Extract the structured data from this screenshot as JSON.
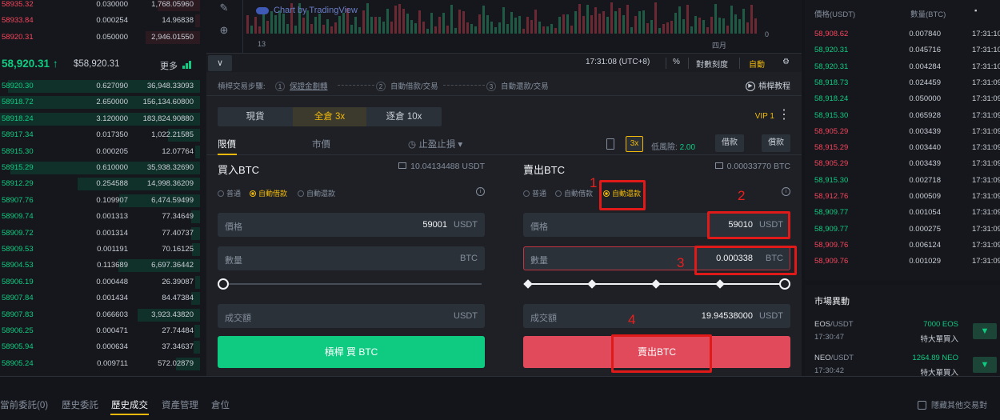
{
  "orderbook": {
    "asks": [
      {
        "price": "58935.32",
        "qty": "0.030000",
        "total": "1,768.05960"
      },
      {
        "price": "58933.84",
        "qty": "0.000254",
        "total": "14.96838"
      },
      {
        "price": "58920.31",
        "qty": "0.050000",
        "total": "2,946.01550"
      }
    ],
    "last_price": "58,920.31",
    "last_arrow": "↑",
    "usd_price": "$58,920.31",
    "more_label": "更多",
    "bids": [
      {
        "price": "58920.30",
        "qty": "0.627090",
        "total": "36,948.33093"
      },
      {
        "price": "58918.72",
        "qty": "2.650000",
        "total": "156,134.60800"
      },
      {
        "price": "58918.24",
        "qty": "3.120000",
        "total": "183,824.90880"
      },
      {
        "price": "58917.34",
        "qty": "0.017350",
        "total": "1,022.21585"
      },
      {
        "price": "58915.30",
        "qty": "0.000205",
        "total": "12.07764"
      },
      {
        "price": "58915.29",
        "qty": "0.610000",
        "total": "35,938.32690"
      },
      {
        "price": "58912.29",
        "qty": "0.254588",
        "total": "14,998.36209"
      },
      {
        "price": "58907.76",
        "qty": "0.109907",
        "total": "6,474.59499"
      },
      {
        "price": "58909.74",
        "qty": "0.001313",
        "total": "77.34649"
      },
      {
        "price": "58909.72",
        "qty": "0.001314",
        "total": "77.40737"
      },
      {
        "price": "58909.53",
        "qty": "0.001191",
        "total": "70.16125"
      },
      {
        "price": "58904.53",
        "qty": "0.113689",
        "total": "6,697.36442"
      },
      {
        "price": "58906.19",
        "qty": "0.000448",
        "total": "26.39087"
      },
      {
        "price": "58907.84",
        "qty": "0.001434",
        "total": "84.47384"
      },
      {
        "price": "58907.83",
        "qty": "0.066603",
        "total": "3,923.43820"
      },
      {
        "price": "58906.25",
        "qty": "0.000471",
        "total": "27.74484"
      },
      {
        "price": "58905.94",
        "qty": "0.000634",
        "total": "37.34637"
      },
      {
        "price": "58905.24",
        "qty": "0.009711",
        "total": "572.02879"
      }
    ]
  },
  "chart": {
    "watermark": "Chart by TradingView",
    "x_labels": [
      "13",
      "四月"
    ],
    "zero_label": "0"
  },
  "chart_bar": {
    "time": "17:31:08 (UTC+8)",
    "percent": "%",
    "log": "對數刻度",
    "auto": "自動"
  },
  "steps": {
    "intro": "槓桿交易步驟:",
    "items": [
      {
        "n": "1",
        "label": "保證金劃轉"
      },
      {
        "n": "2",
        "label": "自動借款/交易"
      },
      {
        "n": "3",
        "label": "自動還款/交易"
      }
    ],
    "tutorial": "槓桿教程"
  },
  "margin_tabs": [
    {
      "label": "現貨"
    },
    {
      "label": "全倉 3x"
    },
    {
      "label": "逐倉 10x"
    }
  ],
  "vip": "VIP 1",
  "order_types": {
    "limit": "限價",
    "market": "市價",
    "stop": "止盈止損 ▾"
  },
  "risk": {
    "leverage": "3x",
    "label": "低風險:",
    "value": "2.00",
    "borrow": "借款",
    "repay": "償款"
  },
  "buy": {
    "title": "買入BTC",
    "balance": "10.04134488 USDT",
    "modes": [
      "普通",
      "自動借款",
      "自動還款"
    ],
    "price_label": "價格",
    "price_value": "59001",
    "price_unit": "USDT",
    "qty_label": "數量",
    "qty_value": "",
    "qty_unit": "BTC",
    "total_label": "成交額",
    "total_value": "",
    "total_unit": "USDT",
    "button": "槓桿 買 BTC",
    "color": "#0ecb81"
  },
  "sell": {
    "title": "賣出BTC",
    "balance": "0.00033770 BTC",
    "modes": [
      "普通",
      "自動借款",
      "自動還款"
    ],
    "price_label": "價格",
    "price_value": "59010",
    "price_unit": "USDT",
    "qty_label": "數量",
    "qty_value": "0.000338",
    "qty_unit": "BTC",
    "total_label": "成交額",
    "total_value": "19.94538000",
    "total_unit": "USDT",
    "button": "賣出BTC",
    "color": "#f6465d",
    "slider_pct": 100
  },
  "trades": {
    "headers": [
      "價格(USDT)",
      "數量(BTC)"
    ],
    "rows": [
      {
        "price": "58,908.62",
        "qty": "0.007840",
        "time": "17:31:10",
        "dir": "dn"
      },
      {
        "price": "58,920.31",
        "qty": "0.045716",
        "time": "17:31:10",
        "dir": "up"
      },
      {
        "price": "58,920.31",
        "qty": "0.004284",
        "time": "17:31:10",
        "dir": "up"
      },
      {
        "price": "58,918.73",
        "qty": "0.024459",
        "time": "17:31:09",
        "dir": "up"
      },
      {
        "price": "58,918.24",
        "qty": "0.050000",
        "time": "17:31:09",
        "dir": "up"
      },
      {
        "price": "58,915.30",
        "qty": "0.065928",
        "time": "17:31:09",
        "dir": "up"
      },
      {
        "price": "58,905.29",
        "qty": "0.003439",
        "time": "17:31:09",
        "dir": "dn"
      },
      {
        "price": "58,915.29",
        "qty": "0.003440",
        "time": "17:31:09",
        "dir": "dn"
      },
      {
        "price": "58,905.29",
        "qty": "0.003439",
        "time": "17:31:09",
        "dir": "dn"
      },
      {
        "price": "58,915.30",
        "qty": "0.002718",
        "time": "17:31:09",
        "dir": "up"
      },
      {
        "price": "58,912.76",
        "qty": "0.000509",
        "time": "17:31:09",
        "dir": "dn"
      },
      {
        "price": "58,909.77",
        "qty": "0.001054",
        "time": "17:31:09",
        "dir": "up"
      },
      {
        "price": "58,909.77",
        "qty": "0.000275",
        "time": "17:31:09",
        "dir": "up"
      },
      {
        "price": "58,909.76",
        "qty": "0.006124",
        "time": "17:31:09",
        "dir": "dn"
      },
      {
        "price": "58,909.76",
        "qty": "0.001029",
        "time": "17:31:09",
        "dir": "dn"
      }
    ]
  },
  "market_moves": {
    "title": "市場異動",
    "items": [
      {
        "base": "EOS",
        "quote": "/USDT",
        "time": "17:30:47",
        "amount": "7000 EOS",
        "desc": "特大單買入"
      },
      {
        "base": "NEO",
        "quote": "/USDT",
        "time": "17:30:42",
        "amount": "1264.89 NEO",
        "desc": "特大單買入"
      }
    ]
  },
  "bottom_tabs": [
    "當前委託(0)",
    "歷史委託",
    "歷史成交",
    "資產管理",
    "倉位"
  ],
  "hide_other": "隱藏其他交易對",
  "annotations": [
    "1",
    "2",
    "3",
    "4"
  ]
}
